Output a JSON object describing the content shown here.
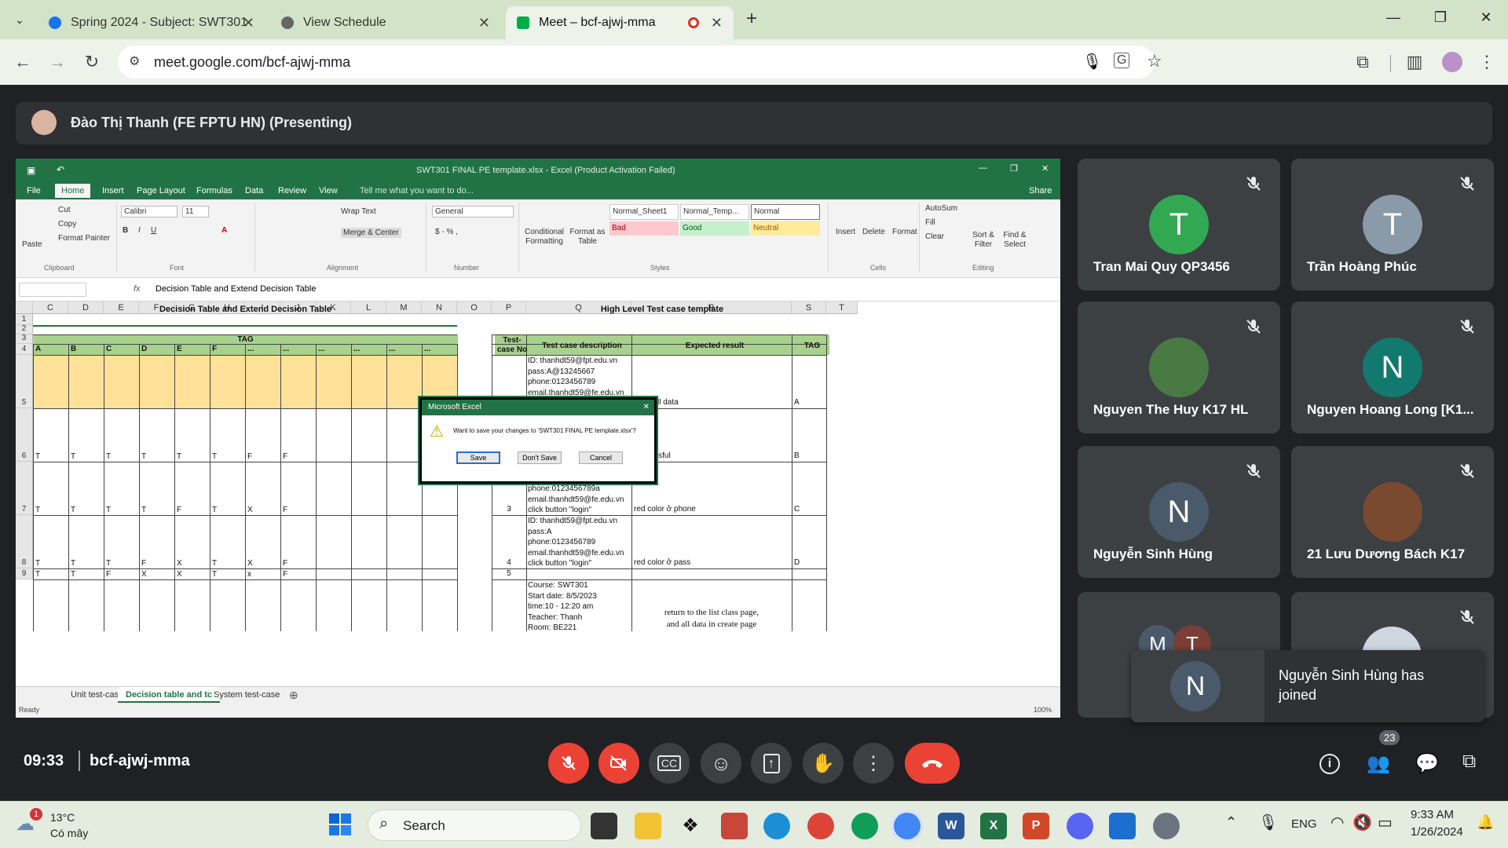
{
  "browser": {
    "tabs": [
      {
        "title": "Spring 2024 - Subject: SWT301",
        "fav_color": "#1a73e8"
      },
      {
        "title": "View Schedule",
        "fav_color": "#555"
      },
      {
        "title": "Meet – bcf-ajwj-mma",
        "fav_color": "#00ac47"
      }
    ],
    "url": "meet.google.com/bcf-ajwj-mma"
  },
  "meet": {
    "presenter": "Đào Thị Thanh (FE FPTU HN) (Presenting)",
    "time": "09:33",
    "meeting_code": "bcf-ajwj-mma",
    "participant_count": "23",
    "participants": [
      {
        "name": "Tran Mai Quy QP3456",
        "initial": "T",
        "color": "#33a852"
      },
      {
        "name": "Trần Hoàng Phúc",
        "initial": "T",
        "color": "#8a9aa8"
      },
      {
        "name": "Nguyen The Huy K17 HL",
        "initial": "",
        "color": "#4a7a44"
      },
      {
        "name": "Nguyen Hoang Long [K1...",
        "initial": "N",
        "color": "#12796f"
      },
      {
        "name": "Nguyễn Sinh Hùng",
        "initial": "N",
        "color": "#4a5a6a"
      },
      {
        "name": "21 Lưu Dương Bách K17",
        "initial": "",
        "color": "#7a4a30"
      }
    ],
    "extra_initials": [
      "M",
      "T"
    ],
    "toast": {
      "initial": "N",
      "text": "Nguyễn Sinh Hùng has joined"
    }
  },
  "excel": {
    "title": "SWT301 FINAL PE template.xlsx - Excel (Product Activation Failed)",
    "menu": [
      "File",
      "Home",
      "Insert",
      "Page Layout",
      "Formulas",
      "Data",
      "Review",
      "View"
    ],
    "tell_me": "Tell me what you want to do...",
    "share": "Share",
    "ribbon": {
      "cut": "Cut",
      "copy": "Copy",
      "format_painter": "Format Painter",
      "paste": "Paste",
      "font": "Calibri",
      "size": "11",
      "wrap": "Wrap Text",
      "merge": "Merge & Center",
      "numfmt": "General",
      "cond": "Conditional Formatting",
      "fmt_table": "Format as Table",
      "styles": [
        "Normal_Sheet1",
        "Normal_Temp...",
        "Normal",
        "Bad",
        "Good",
        "Neutral"
      ],
      "insert": "Insert",
      "delete": "Delete",
      "format": "Format",
      "autosum": "AutoSum",
      "fill": "Fill",
      "clear": "Clear",
      "sort": "Sort & Filter",
      "find": "Find & Select",
      "groups": [
        "Clipboard",
        "Font",
        "Alignment",
        "Number",
        "Styles",
        "Cells",
        "Editing"
      ]
    },
    "formula": "Decision Table and Extend Decision Table",
    "columns": [
      "C",
      "D",
      "E",
      "F",
      "G",
      "H",
      "I",
      "J",
      "K",
      "L",
      "M",
      "N",
      "O",
      "P",
      "Q",
      "R",
      "S",
      "T"
    ],
    "rows": [
      "1",
      "2",
      "3",
      "4",
      "5",
      "6",
      "7",
      "8",
      "9"
    ],
    "title_left": "Decision Table and Extend Decision Table",
    "title_right": "High Level Test case template",
    "tag": "TAG",
    "tag_cols": [
      "A",
      "B",
      "C",
      "D",
      "E",
      "F",
      "...",
      "...",
      "...",
      "...",
      "...",
      "..."
    ],
    "right_headers": [
      "Test-case No",
      "Test case description",
      "Expected result",
      "TAG"
    ],
    "row6": [
      "T",
      "T",
      "T",
      "T",
      "T",
      "T",
      "F",
      "F"
    ],
    "row7": [
      "T",
      "T",
      "T",
      "T",
      "F",
      "T",
      "X",
      "F"
    ],
    "row8": [
      "T",
      "T",
      "T",
      "F",
      "X",
      "T",
      "X",
      "F"
    ],
    "row9": [
      "T",
      "T",
      "F",
      "X",
      "X",
      "T",
      "x",
      "F"
    ],
    "tc": [
      {
        "no": "",
        "desc": [
          "ID: thanhdt59@fpt.edu.vn",
          "pass:A@13245667",
          "phone:0123456789",
          "email.thanhdt59@fe.edu.vn",
          "click button \"cancel\""
        ],
        "exp": "clear all data",
        "tag": "A"
      },
      {
        "no": "",
        "desc": [
          "ID: thanhdt59@fpt.edu.vn",
          "pass:A@13245667",
          "phone:0123456789",
          "email.thanhdt59@fe.edu.vn",
          "click button \"login\""
        ],
        "exp": "successful",
        "tag": "B"
      },
      {
        "no": "3",
        "desc": [
          "ID: thanhdt59@fpt.edu.vn",
          "pass:A@13245667",
          "phone:0123456789a",
          "email.thanhdt59@fe.edu.vn",
          "click button \"login\""
        ],
        "exp": "red color ở phone",
        "tag": "C"
      },
      {
        "no": "4",
        "desc": [
          "ID: thanhdt59@fpt.edu.vn",
          "pass:A",
          "phone:0123456789",
          "email.thanhdt59@fe.edu.vn",
          "click button \"login\""
        ],
        "exp": "red color ở pass",
        "tag": "D"
      }
    ],
    "row9_no": "5",
    "course": [
      "Course: SWT301",
      "Start date: 8/5/2023",
      "time:10 - 12:20 am",
      "Teacher: Thanh",
      "Room: BE221"
    ],
    "course_exp": [
      "return to the list class page,",
      "and all data in create page"
    ],
    "sheets": [
      "Unit test-case",
      "Decision table and tc",
      "System test-case"
    ],
    "status": "Ready",
    "zoom": "100%",
    "dialog": {
      "title": "Microsoft Excel",
      "message": "Want to save your changes to 'SWT301 FINAL PE template.xlsx'?",
      "save": "Save",
      "dont_save": "Don't Save",
      "cancel": "Cancel"
    }
  },
  "taskbar": {
    "temp": "13°C",
    "weather": "Có mây",
    "badge": "1",
    "search": "Search",
    "lang": "ENG",
    "time": "9:33 AM",
    "date": "1/26/2024"
  }
}
